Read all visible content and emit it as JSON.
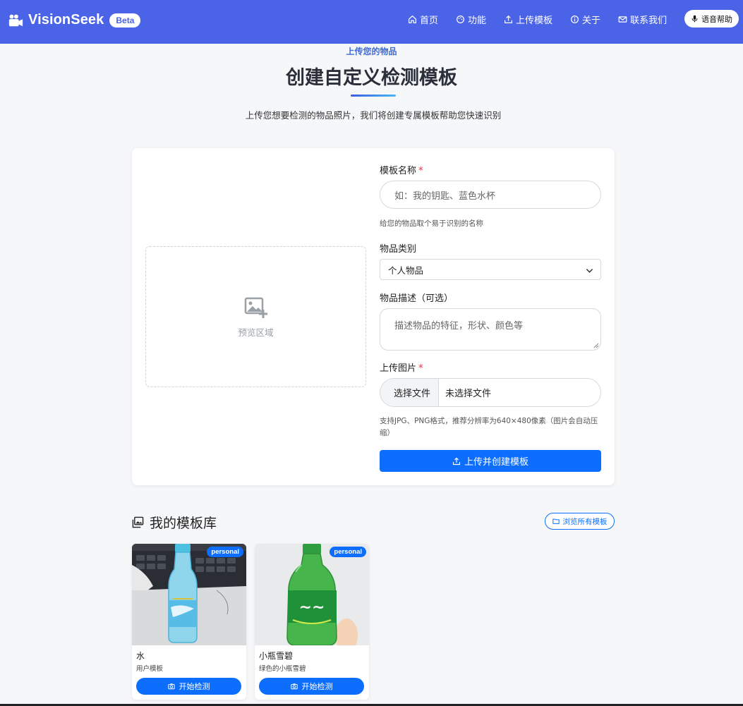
{
  "brand": {
    "name": "VisionSeek",
    "badge": "Beta"
  },
  "nav": {
    "items": [
      {
        "label": "首页",
        "icon": "home-icon"
      },
      {
        "label": "功能",
        "icon": "palette-icon"
      },
      {
        "label": "上传模板",
        "icon": "upload-icon"
      },
      {
        "label": "关于",
        "icon": "info-icon"
      },
      {
        "label": "联系我们",
        "icon": "envelope-icon"
      }
    ],
    "voice_label": "语音帮助"
  },
  "header": {
    "eyebrow": "上传您的物品",
    "title": "创建自定义检测模板",
    "description": "上传您想要检测的物品照片，我们将创建专属模板帮助您快速识别"
  },
  "preview": {
    "label": "预览区域"
  },
  "form": {
    "name_label": "模板名称",
    "name_placeholder": "如：我的钥匙、蓝色水杯",
    "name_hint": "给您的物品取个易于识别的名称",
    "category_label": "物品类别",
    "category_value": "个人物品",
    "description_label": "物品描述（可选）",
    "description_placeholder": "描述物品的特征，形状、颜色等",
    "image_label": "上传图片",
    "file_button": "选择文件",
    "file_status": "未选择文件",
    "image_hint": "支持JPG、PNG格式，推荐分辨率为640×480像素（图片会自动压缩）",
    "submit_label": "上传并创建模板",
    "required_mark": "*"
  },
  "library": {
    "title": "我的模板库",
    "browse_label": "浏览所有模板",
    "templates": [
      {
        "name": "水",
        "description": "用户模板",
        "badge": "personal",
        "action": "开始检测"
      },
      {
        "name": "小瓶雪碧",
        "description": "绿色的小瓶雪碧",
        "badge": "personal",
        "action": "开始检测"
      }
    ]
  },
  "colors": {
    "navbar": "#4a63e7",
    "primary": "#0d6efd",
    "accent_text": "#3f6bd8"
  }
}
